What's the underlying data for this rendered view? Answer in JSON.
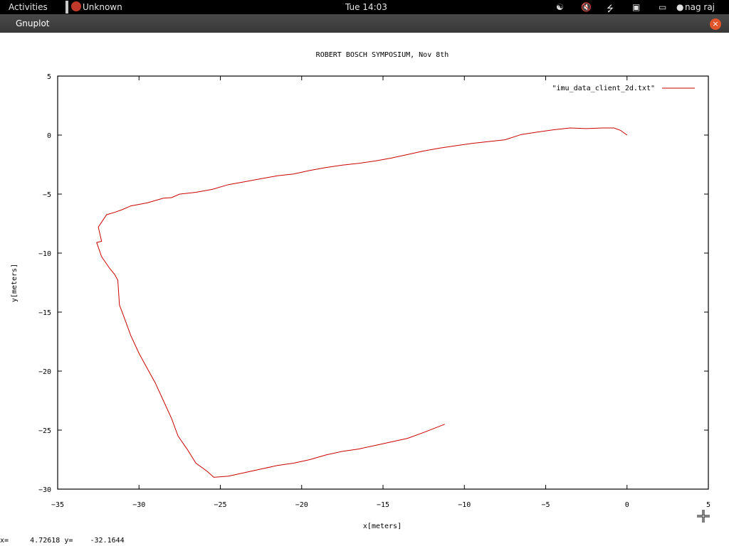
{
  "topbar": {
    "activities": "Activities",
    "app_name": "Unknown",
    "clock": "Tue 14:03",
    "user": "nag raj",
    "icons": [
      "accessibility-icon",
      "volume-muted-icon",
      "bluetooth-icon",
      "network-signal-icon",
      "battery-icon",
      "user-icon"
    ]
  },
  "window": {
    "title": "Gnuplot",
    "close_label": "×"
  },
  "chart_data": {
    "type": "line",
    "title": "ROBERT BOSCH SYMPOSIUM, Nov 8th",
    "xlabel": "x[meters]",
    "ylabel": "y[meters]",
    "xlim": [
      -35,
      5
    ],
    "ylim": [
      -30,
      5
    ],
    "xticks": [
      -35,
      -30,
      -25,
      -20,
      -15,
      -10,
      -5,
      0,
      5
    ],
    "yticks": [
      -30,
      -25,
      -20,
      -15,
      -10,
      -5,
      0,
      5
    ],
    "xtick_labels": [
      "−35",
      "−30",
      "−25",
      "−20",
      "−15",
      "−10",
      "−5",
      "0",
      "5"
    ],
    "ytick_labels": [
      "−30",
      "−25",
      "−20",
      "−15",
      "−10",
      "−5",
      "0",
      "5"
    ],
    "grid": false,
    "legend_position": "top-right",
    "series": [
      {
        "name": "\"imu_data_client_2d.txt\"",
        "color": "#cc0000",
        "points": [
          [
            0,
            0
          ],
          [
            -0.4,
            0.4
          ],
          [
            -0.8,
            0.6
          ],
          [
            -1.5,
            0.6
          ],
          [
            -2.5,
            0.55
          ],
          [
            -3.5,
            0.6
          ],
          [
            -4.5,
            0.45
          ],
          [
            -5.5,
            0.25
          ],
          [
            -6.5,
            0.05
          ],
          [
            -7.5,
            -0.4
          ],
          [
            -8.5,
            -0.55
          ],
          [
            -9.5,
            -0.7
          ],
          [
            -10.5,
            -0.9
          ],
          [
            -11.5,
            -1.1
          ],
          [
            -12.5,
            -1.35
          ],
          [
            -13.5,
            -1.65
          ],
          [
            -14.5,
            -1.95
          ],
          [
            -15.5,
            -2.2
          ],
          [
            -16.5,
            -2.4
          ],
          [
            -17.5,
            -2.55
          ],
          [
            -18.5,
            -2.75
          ],
          [
            -19.5,
            -3.0
          ],
          [
            -20.5,
            -3.3
          ],
          [
            -21.5,
            -3.45
          ],
          [
            -22.5,
            -3.7
          ],
          [
            -23.5,
            -3.95
          ],
          [
            -24.5,
            -4.2
          ],
          [
            -25.5,
            -4.6
          ],
          [
            -26.5,
            -4.85
          ],
          [
            -27.5,
            -5.0
          ],
          [
            -28.0,
            -5.3
          ],
          [
            -28.5,
            -5.35
          ],
          [
            -29.5,
            -5.75
          ],
          [
            -30.5,
            -6.0
          ],
          [
            -31.0,
            -6.3
          ],
          [
            -31.5,
            -6.55
          ],
          [
            -32.0,
            -6.75
          ],
          [
            -32.5,
            -7.8
          ],
          [
            -32.3,
            -9.0
          ],
          [
            -32.6,
            -9.1
          ],
          [
            -32.3,
            -10.3
          ],
          [
            -31.8,
            -11.3
          ],
          [
            -31.5,
            -11.8
          ],
          [
            -31.3,
            -12.3
          ],
          [
            -31.2,
            -14.4
          ],
          [
            -30.9,
            -15.5
          ],
          [
            -30.5,
            -17.0
          ],
          [
            -30.0,
            -18.5
          ],
          [
            -29.6,
            -19.5
          ],
          [
            -29.0,
            -21.0
          ],
          [
            -28.5,
            -22.5
          ],
          [
            -28.0,
            -24.0
          ],
          [
            -27.6,
            -25.5
          ],
          [
            -27.0,
            -26.7
          ],
          [
            -26.5,
            -27.8
          ],
          [
            -25.8,
            -28.5
          ],
          [
            -25.4,
            -29.0
          ],
          [
            -24.5,
            -28.9
          ],
          [
            -23.5,
            -28.6
          ],
          [
            -22.5,
            -28.3
          ],
          [
            -21.5,
            -28.0
          ],
          [
            -20.5,
            -27.8
          ],
          [
            -19.5,
            -27.5
          ],
          [
            -18.5,
            -27.1
          ],
          [
            -17.5,
            -26.8
          ],
          [
            -16.5,
            -26.6
          ],
          [
            -15.5,
            -26.3
          ],
          [
            -14.5,
            -26.0
          ],
          [
            -13.5,
            -25.7
          ],
          [
            -12.5,
            -25.2
          ],
          [
            -11.2,
            -24.5
          ]
        ]
      }
    ]
  },
  "status_line": {
    "x_label": "x=",
    "x_value": "4.72618",
    "y_label": "y=",
    "y_value": "-32.1644"
  }
}
